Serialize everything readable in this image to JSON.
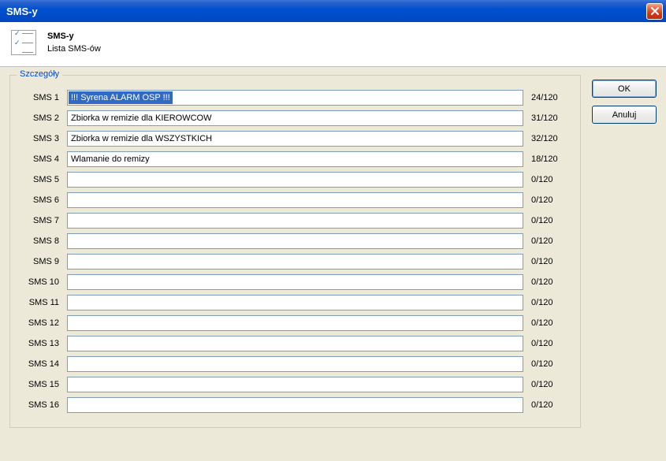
{
  "window": {
    "title": "SMS-y"
  },
  "header": {
    "title": "SMS-y",
    "subtitle": "Lista SMS-ów"
  },
  "group": {
    "label": "Szczegóły"
  },
  "max_len": 120,
  "sms": [
    {
      "label": "SMS 1",
      "value": "!!! Syrena ALARM OSP !!!",
      "count": "24/120",
      "selected": true
    },
    {
      "label": "SMS 2",
      "value": "Zbiorka w remizie dla KIEROWCOW",
      "count": "31/120"
    },
    {
      "label": "SMS 3",
      "value": "Zbiorka w remizie dla WSZYSTKICH",
      "count": "32/120"
    },
    {
      "label": "SMS 4",
      "value": "Wlamanie do remizy",
      "count": "18/120"
    },
    {
      "label": "SMS 5",
      "value": "",
      "count": "0/120"
    },
    {
      "label": "SMS 6",
      "value": "",
      "count": "0/120"
    },
    {
      "label": "SMS 7",
      "value": "",
      "count": "0/120"
    },
    {
      "label": "SMS 8",
      "value": "",
      "count": "0/120"
    },
    {
      "label": "SMS 9",
      "value": "",
      "count": "0/120"
    },
    {
      "label": "SMS 10",
      "value": "",
      "count": "0/120"
    },
    {
      "label": "SMS 11",
      "value": "",
      "count": "0/120"
    },
    {
      "label": "SMS 12",
      "value": "",
      "count": "0/120"
    },
    {
      "label": "SMS 13",
      "value": "",
      "count": "0/120"
    },
    {
      "label": "SMS 14",
      "value": "",
      "count": "0/120"
    },
    {
      "label": "SMS 15",
      "value": "",
      "count": "0/120"
    },
    {
      "label": "SMS 16",
      "value": "",
      "count": "0/120"
    }
  ],
  "buttons": {
    "ok": "OK",
    "cancel": "Anuluj"
  }
}
